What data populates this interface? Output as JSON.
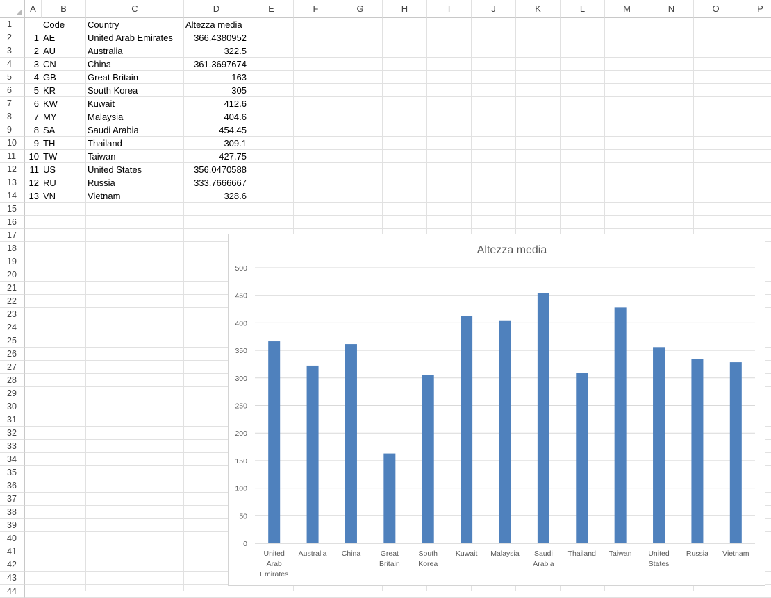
{
  "columns": [
    "A",
    "B",
    "C",
    "D",
    "E",
    "F",
    "G",
    "H",
    "I",
    "J",
    "K",
    "L",
    "M",
    "N",
    "O",
    "P"
  ],
  "rows": [
    "1",
    "2",
    "3",
    "4",
    "5",
    "6",
    "7",
    "8",
    "9",
    "10",
    "11",
    "12",
    "13",
    "14",
    "15",
    "16",
    "17",
    "18",
    "19",
    "20",
    "21",
    "22",
    "23",
    "24",
    "25",
    "26",
    "27",
    "28",
    "29",
    "30",
    "31",
    "32",
    "33",
    "34",
    "35",
    "36",
    "37",
    "38",
    "39",
    "40",
    "41",
    "42",
    "43",
    "44"
  ],
  "table": {
    "headers": [
      "Code",
      "Country",
      "Altezza media"
    ],
    "rows": [
      {
        "n": "1",
        "code": "AE",
        "country": "United Arab Emirates",
        "value": "366.4380952"
      },
      {
        "n": "2",
        "code": "AU",
        "country": "Australia",
        "value": "322.5"
      },
      {
        "n": "3",
        "code": "CN",
        "country": "China",
        "value": "361.3697674"
      },
      {
        "n": "4",
        "code": "GB",
        "country": "Great Britain",
        "value": "163"
      },
      {
        "n": "5",
        "code": "KR",
        "country": "South Korea",
        "value": "305"
      },
      {
        "n": "6",
        "code": "KW",
        "country": "Kuwait",
        "value": "412.6"
      },
      {
        "n": "7",
        "code": "MY",
        "country": "Malaysia",
        "value": "404.6"
      },
      {
        "n": "8",
        "code": "SA",
        "country": "Saudi Arabia",
        "value": "454.45"
      },
      {
        "n": "9",
        "code": "TH",
        "country": "Thailand",
        "value": "309.1"
      },
      {
        "n": "10",
        "code": "TW",
        "country": "Taiwan",
        "value": "427.75"
      },
      {
        "n": "11",
        "code": "US",
        "country": "United States",
        "value": "356.0470588"
      },
      {
        "n": "12",
        "code": "RU",
        "country": "Russia",
        "value": "333.7666667"
      },
      {
        "n": "13",
        "code": "VN",
        "country": "Vietnam",
        "value": "328.6"
      }
    ]
  },
  "chart_data": {
    "type": "bar",
    "title": "Altezza media",
    "categories": [
      [
        "United",
        "Arab",
        "Emirates"
      ],
      [
        "Australia"
      ],
      [
        "China"
      ],
      [
        "Great",
        "Britain"
      ],
      [
        "South",
        "Korea"
      ],
      [
        "Kuwait"
      ],
      [
        "Malaysia"
      ],
      [
        "Saudi",
        "Arabia"
      ],
      [
        "Thailand"
      ],
      [
        "Taiwan"
      ],
      [
        "United",
        "States"
      ],
      [
        "Russia"
      ],
      [
        "Vietnam"
      ]
    ],
    "values": [
      366.4380952,
      322.5,
      361.3697674,
      163,
      305,
      412.6,
      404.6,
      454.45,
      309.1,
      427.75,
      356.0470588,
      333.7666667,
      328.6
    ],
    "ylim": [
      0,
      500
    ],
    "yticks": [
      "0",
      "50",
      "100",
      "150",
      "200",
      "250",
      "300",
      "350",
      "400",
      "450",
      "500"
    ],
    "grid": true,
    "legend": "none",
    "bar_color": "#4F81BD"
  }
}
